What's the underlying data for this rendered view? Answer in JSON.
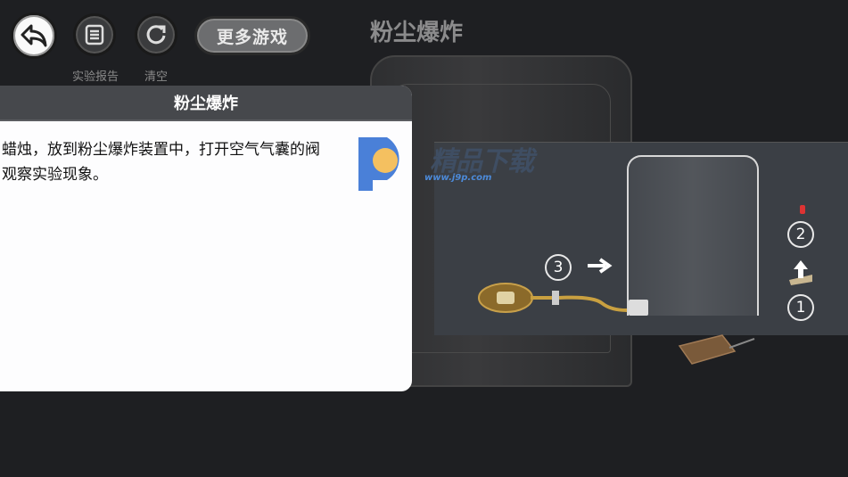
{
  "toolbar": {
    "back_icon": "back-arrow-icon",
    "report_label": "实验报告",
    "clear_label": "清空",
    "more_games_label": "更多游戏"
  },
  "page": {
    "title": "粉尘爆炸"
  },
  "panel": {
    "title": "粉尘爆炸",
    "text": "蜡烛，放到粉尘爆炸装置中，打开空气气囊的阀\n观察实验现象。"
  },
  "watermark": {
    "brand": "精品下载",
    "url": "www.j9p.com"
  },
  "diagram": {
    "step1": "1",
    "step2": "2",
    "step3": "3"
  }
}
